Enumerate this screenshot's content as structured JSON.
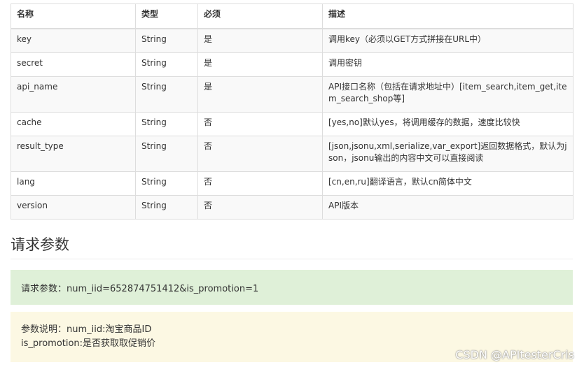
{
  "table": {
    "headers": [
      "名称",
      "类型",
      "必须",
      "描述"
    ],
    "rows": [
      {
        "name": "key",
        "type": "String",
        "required": "是",
        "desc": "调用key（必须以GET方式拼接在URL中）"
      },
      {
        "name": "secret",
        "type": "String",
        "required": "是",
        "desc": "调用密钥"
      },
      {
        "name": "api_name",
        "type": "String",
        "required": "是",
        "desc": "API接口名称（包括在请求地址中）[item_search,item_get,item_search_shop等]"
      },
      {
        "name": "cache",
        "type": "String",
        "required": "否",
        "desc": "[yes,no]默认yes，将调用缓存的数据，速度比较快"
      },
      {
        "name": "result_type",
        "type": "String",
        "required": "否",
        "desc": "[json,jsonu,xml,serialize,var_export]返回数据格式，默认为json，jsonu输出的内容中文可以直接阅读"
      },
      {
        "name": "lang",
        "type": "String",
        "required": "否",
        "desc": "[cn,en,ru]翻译语言，默认cn简体中文"
      },
      {
        "name": "version",
        "type": "String",
        "required": "否",
        "desc": "API版本"
      }
    ]
  },
  "section_title": "请求参数",
  "request_params": "请求参数：num_iid=652874751412&is_promotion=1",
  "param_desc": {
    "line1": "参数说明：num_iid:淘宝商品ID",
    "line2": "is_promotion:是否获取取促销价"
  },
  "watermark": "CSDN @APItesterCris"
}
